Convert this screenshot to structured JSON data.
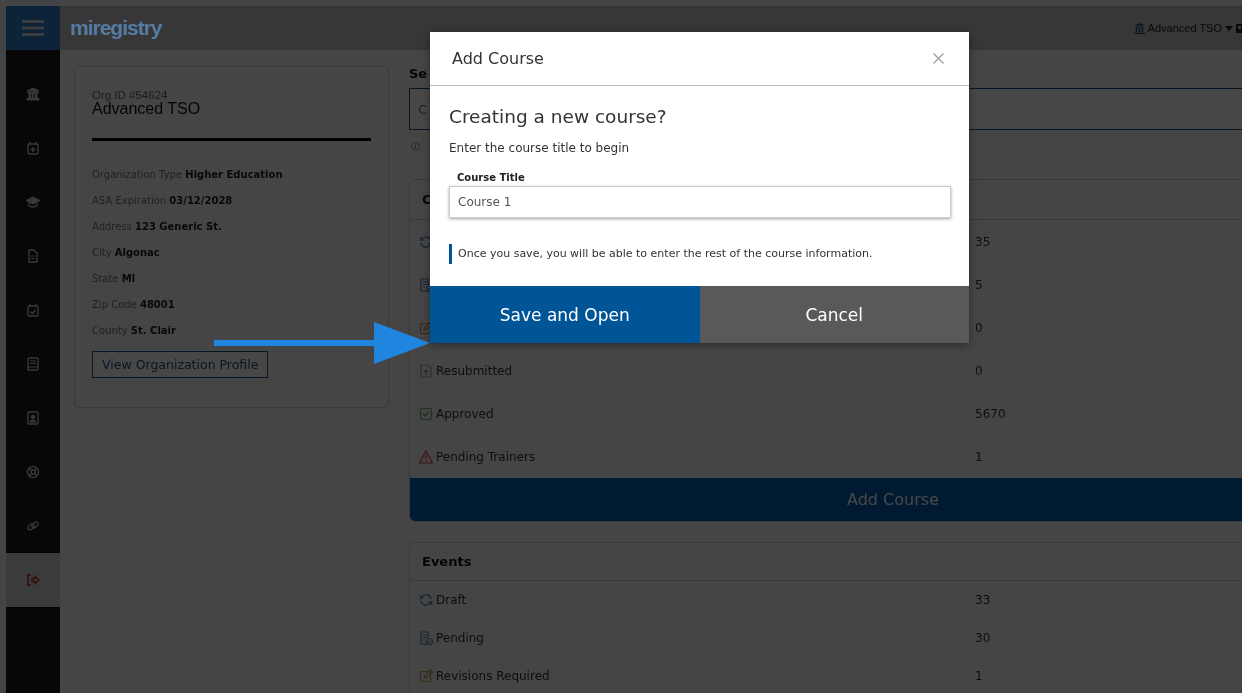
{
  "header": {
    "logo": "miregistry",
    "user_menu": "Advanced TSO"
  },
  "sidebar": {
    "items": [
      {
        "selected": false
      },
      {
        "selected": false
      },
      {
        "selected": false
      },
      {
        "selected": false
      },
      {
        "selected": false
      },
      {
        "selected": false
      },
      {
        "selected": false
      },
      {
        "selected": false
      },
      {
        "selected": false
      },
      {
        "selected": true
      }
    ]
  },
  "org_card": {
    "org_id": "Org ID #54624",
    "name": "Advanced TSO",
    "fields": [
      "Organization Type **Higher Education**",
      "ASA Expiration **03/12/2028**",
      "Address **123 Generic St.**",
      "City **Algonac**",
      "State **MI**",
      "Zip Code **48001**",
      "County **St. Clair**"
    ],
    "button": "View Organization Profile"
  },
  "search": {
    "heading": "Se",
    "placeholder": "C"
  },
  "courses": {
    "heading": "C",
    "rows": [
      {
        "kind": "draft",
        "value": "35"
      },
      {
        "kind": "pending",
        "value": "5"
      },
      {
        "kind": "revisions",
        "value": "0"
      },
      {
        "kind": "resubmitted",
        "label": "Resubmitted",
        "value": "0"
      },
      {
        "kind": "approved",
        "label": "Approved",
        "value": "5670"
      },
      {
        "kind": "warning",
        "label": "Pending Trainers",
        "value": "1"
      }
    ],
    "button": "Add Course"
  },
  "events": {
    "heading": "Events",
    "rows": [
      {
        "kind": "draft",
        "label": "Draft",
        "value": "33"
      },
      {
        "kind": "pending",
        "label": "Pending",
        "value": "30"
      },
      {
        "kind": "revisions",
        "label": "Revisions Required",
        "value": "1"
      }
    ]
  },
  "modal": {
    "title": "Add Course",
    "heading": "Creating a new course?",
    "subtitle": "Enter the course title to begin",
    "field_label": "Course Title",
    "field_value": "Course 1",
    "note": "Once you save, you will be able to enter the rest of the course information.",
    "buttons": [
      {
        "kind": "primary",
        "label": "Save and Open"
      },
      {
        "kind": "secondary",
        "label": "Cancel"
      }
    ]
  }
}
